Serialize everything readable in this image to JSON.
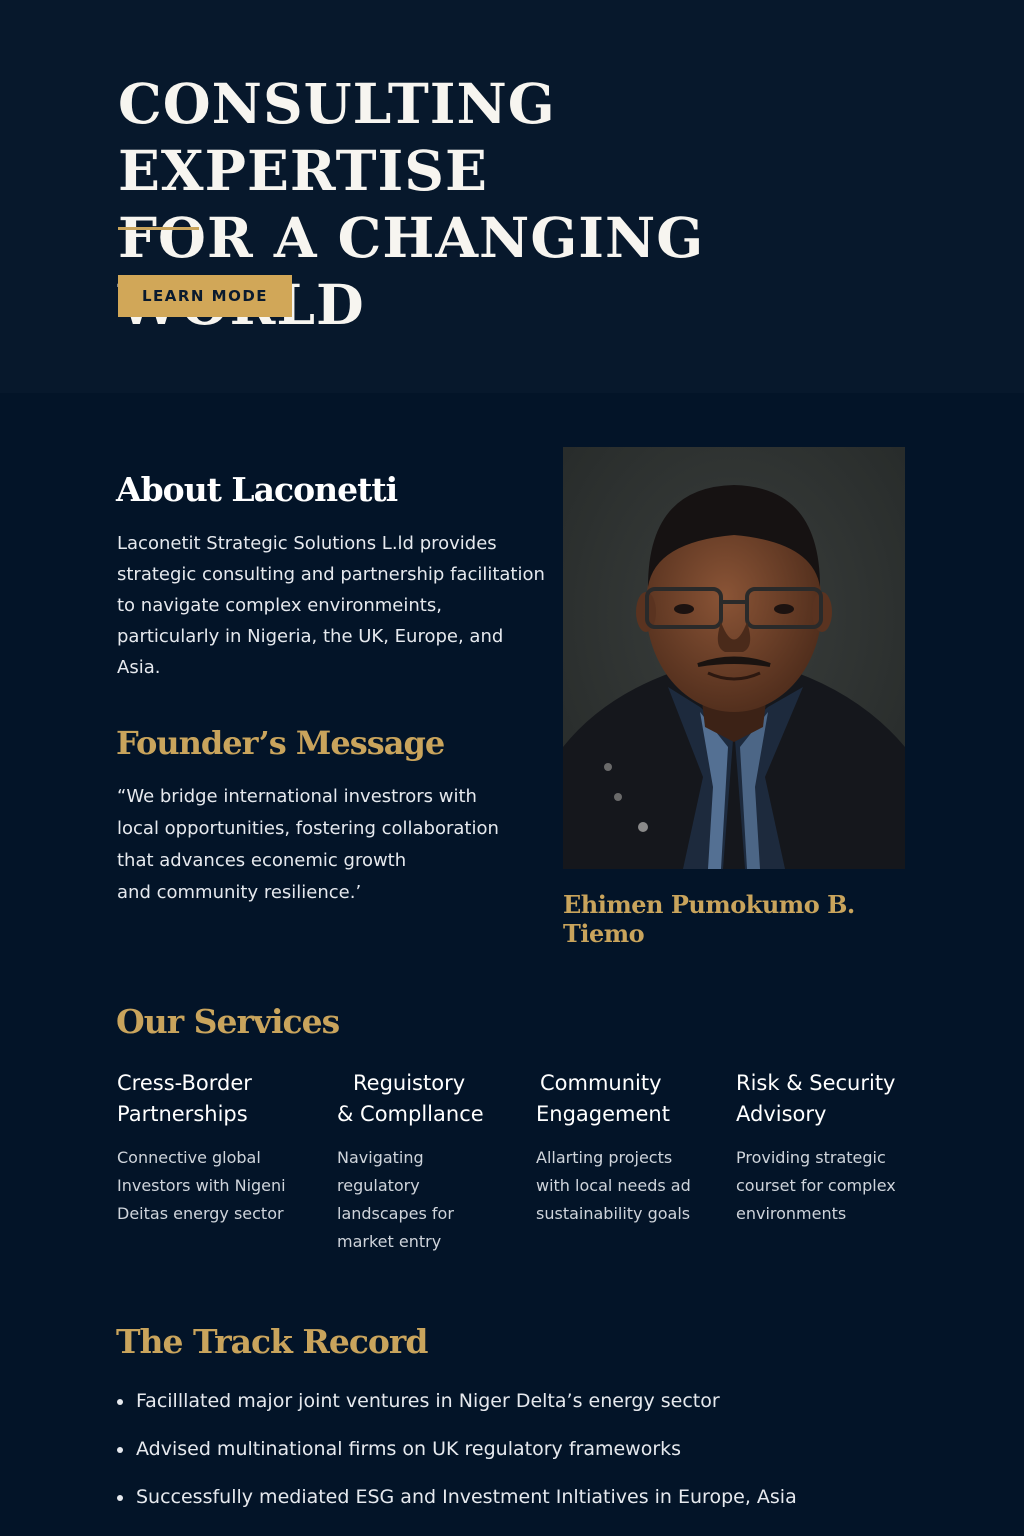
{
  "hero": {
    "title_line1": "CONSULTING EXPERTISE",
    "title_line2": "FOR A CHANGING WORLD",
    "cta_label": "LEARN MODE"
  },
  "about": {
    "title": "About Laconetti",
    "body": "Laconetit Strategic Solutions L.ld provides strategic consulting and partnership facilitation to navigate complex environmeints, particularly in Nigeria, the UK, Europe, and Asia."
  },
  "founder": {
    "title": "Founder’s Message",
    "quote_lines": [
      "“We bridge international investrors with",
      "local opportunities, fostering collaboration",
      "that advances econemic growth",
      "and community resilience.’"
    ],
    "name": "Ehimen Pumokumo B. Tiemo"
  },
  "services": {
    "title": "Our Services",
    "items": [
      {
        "name_lines": [
          "Cress-Border",
          "Partnerships"
        ],
        "desc_lines": [
          "Connective global",
          "Investors with Nigeni",
          "Deitas energy sector"
        ]
      },
      {
        "name_lines": [
          "Reguistory",
          "& Compllance"
        ],
        "desc_lines": [
          "Navigating",
          "regulatory",
          "landscapes for",
          "market entry"
        ]
      },
      {
        "name_lines": [
          "Community",
          "Engagement"
        ],
        "desc_lines": [
          "Allarting projects",
          "with local needs ad",
          "sustainability goals"
        ]
      },
      {
        "name_lines": [
          "Risk & Security",
          "Advisory"
        ],
        "desc_lines": [
          "Providing strategic",
          "courset for complex",
          "environments"
        ]
      }
    ]
  },
  "track_record": {
    "title": "The Track Record",
    "items": [
      "Facilllated major joint ventures in Niger Delta’s energy sector",
      "Advised multinational firms on UK regulatory frameworks",
      "Successfully mediated ESG and Investment Inltiatives in Europe, Asia"
    ]
  },
  "colors": {
    "hero_background": "#07182c",
    "page_background": "#031428",
    "accent_gold": "#c9a45c",
    "button_gold": "#d1a758"
  }
}
